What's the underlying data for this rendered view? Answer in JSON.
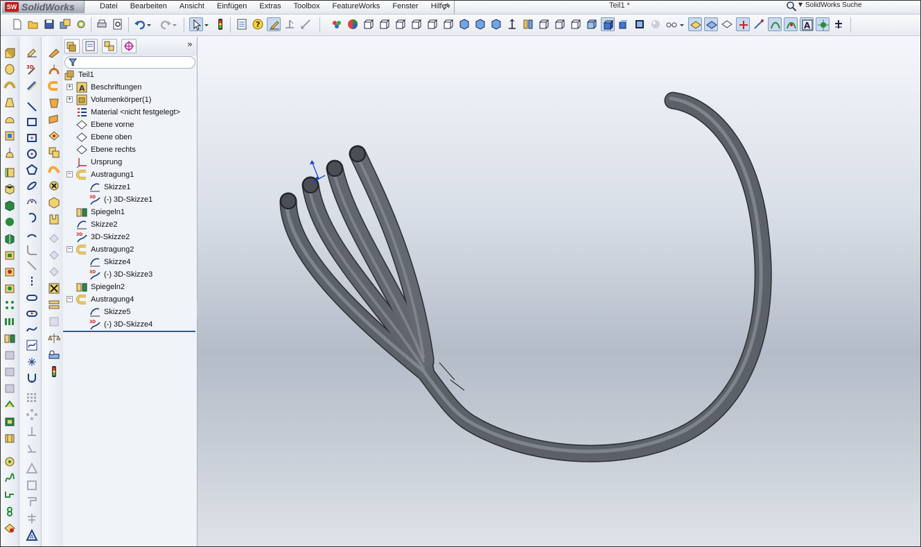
{
  "app": {
    "name": "SolidWorks",
    "logo_mark": "SW",
    "document_title": "Teil1 *"
  },
  "menu": [
    "Datei",
    "Bearbeiten",
    "Ansicht",
    "Einfügen",
    "Extras",
    "Toolbox",
    "FeatureWorks",
    "Fenster",
    "Hilfe"
  ],
  "search": {
    "placeholder": "SolidWorks Suche",
    "icon": "search-icon"
  },
  "toolbar": {
    "icons": [
      "new-icon",
      "open-icon",
      "save-icon",
      "options-icon",
      "print-icon",
      "print-preview-icon",
      "undo-icon",
      "redo-icon",
      "select-icon",
      "rebuild-icon",
      "properties-icon",
      "help-icon",
      "view-orientation-icon",
      "zoom-icon",
      "camera-icon",
      "appearance-icon",
      "section-icon",
      "standard-views-icons",
      "shaded-icon",
      "realview-icon",
      "display-style-icon"
    ]
  },
  "feature_manager": {
    "tabs": [
      "featuremanager-tab",
      "propertymanager-tab",
      "configurationmanager-tab",
      "dimxpert-tab"
    ],
    "more_label": "»",
    "tree": [
      {
        "label": "Teil1",
        "icon": "part-icon",
        "level": 0,
        "expander": ""
      },
      {
        "label": "Beschriftungen",
        "icon": "annotations-icon",
        "level": 1,
        "expander": "+"
      },
      {
        "label": "Volumenkörper(1)",
        "icon": "solid-bodies-icon",
        "level": 1,
        "expander": "+"
      },
      {
        "label": "Material <nicht festgelegt>",
        "icon": "material-icon",
        "level": 1,
        "expander": ""
      },
      {
        "label": "Ebene vorne",
        "icon": "plane-icon",
        "level": 1,
        "expander": ""
      },
      {
        "label": "Ebene oben",
        "icon": "plane-icon",
        "level": 1,
        "expander": ""
      },
      {
        "label": "Ebene rechts",
        "icon": "plane-icon",
        "level": 1,
        "expander": ""
      },
      {
        "label": "Ursprung",
        "icon": "origin-icon",
        "level": 1,
        "expander": ""
      },
      {
        "label": "Austragung1",
        "icon": "sweep-icon",
        "level": 1,
        "expander": "−"
      },
      {
        "label": "Skizze1",
        "icon": "sketch-icon",
        "level": 2,
        "expander": ""
      },
      {
        "label": "(-) 3D-Skizze1",
        "icon": "3d-sketch-icon",
        "level": 2,
        "expander": ""
      },
      {
        "label": "Spiegeln1",
        "icon": "mirror-icon",
        "level": 1,
        "expander": ""
      },
      {
        "label": "Skizze2",
        "icon": "sketch-icon",
        "level": 1,
        "expander": ""
      },
      {
        "label": "3D-Skizze2",
        "icon": "3d-sketch-icon",
        "level": 1,
        "expander": ""
      },
      {
        "label": "Austragung2",
        "icon": "sweep-icon",
        "level": 1,
        "expander": "−"
      },
      {
        "label": "Skizze4",
        "icon": "sketch-icon",
        "level": 2,
        "expander": ""
      },
      {
        "label": "(-) 3D-Skizze3",
        "icon": "3d-sketch-icon",
        "level": 2,
        "expander": ""
      },
      {
        "label": "Spiegeln2",
        "icon": "mirror-icon",
        "level": 1,
        "expander": ""
      },
      {
        "label": "Austragung4",
        "icon": "sweep-icon",
        "level": 1,
        "expander": "−"
      },
      {
        "label": "Skizze5",
        "icon": "sketch-icon",
        "level": 2,
        "expander": ""
      },
      {
        "label": "(-) 3D-Skizze4",
        "icon": "3d-sketch-icon",
        "level": 2,
        "expander": ""
      }
    ]
  },
  "colors": {
    "accent": "#1f5fae",
    "model": "#5c6169",
    "highlight_tab": "#c9d9ee"
  }
}
